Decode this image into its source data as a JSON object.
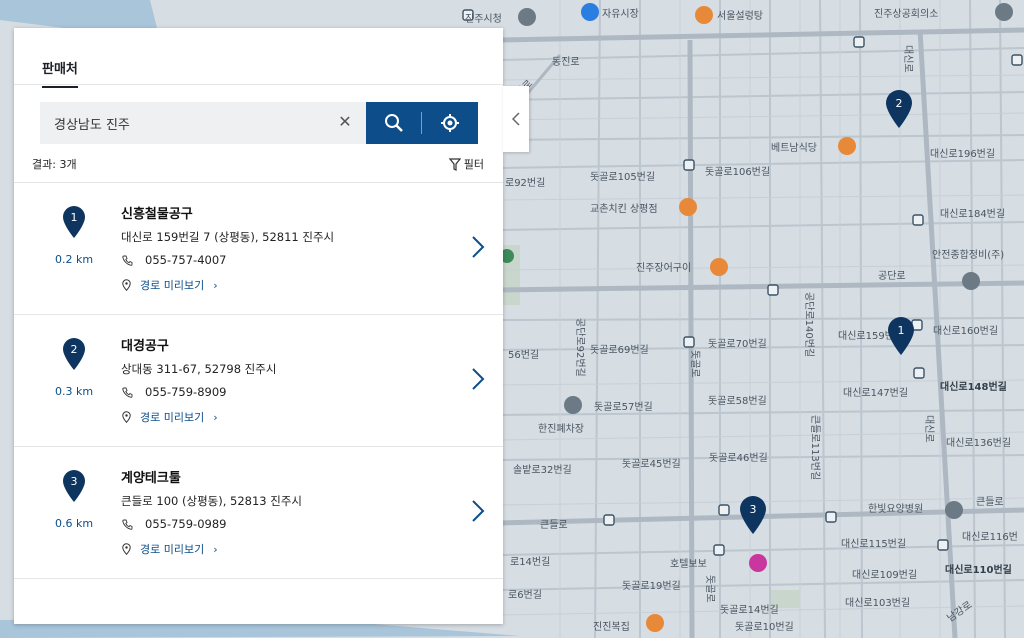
{
  "map": {
    "labels": {
      "jinju_city_hall": "진주시청",
      "jayu_market": "자유시장",
      "seoul_seolleongtang": "서울설렁탕",
      "jinju_chamber": "진주상공회의소",
      "dongjinro": "동진로",
      "dodongcheonro": "도동천로",
      "daesinro_v1": "대신로",
      "betnam": "베트남식당",
      "daesinro196": "대신로196번길",
      "dotgol105": "돗골로105번길",
      "dotgol106": "돗골로106번길",
      "ro292": "로92번길",
      "gyochon": "교촌치킨 상평점",
      "daesinro184": "대신로184번길",
      "anjin": "안전종합정비(주)",
      "jinju_eel": "진주장어구이",
      "gongdanro": "공단로",
      "daesinro159": "대신로159번",
      "daesinro160": "대신로160번길",
      "gongdanro140": "공단로140번길",
      "gongdanro92": "공단로92번길",
      "ro56": "56번길",
      "dotgol69": "돗골로69번길",
      "dotgol70": "돗골로70번길",
      "daesinro148": "대신로148번길",
      "dotgolro_v": "돗골로",
      "daesinro147": "대신로147번길",
      "dotgol57": "돗골로57번길",
      "dotgol58": "돗골로58번길",
      "hanjin": "한진폐차장",
      "daesinro136": "대신로136번길",
      "daesinro_v2": "대신로",
      "keundeulro113": "큰들로113번길",
      "solbat32": "솔밭로32번길",
      "dotgol45": "돗골로45번길",
      "dotgol46": "돗골로46번길",
      "hanbit": "한빛요양병원",
      "keundeulro_r": "큰들로",
      "keundeulro_l": "큰들로",
      "daesinro116": "대신로116번",
      "daesinro115": "대신로115번길",
      "ro14": "로14번길",
      "hotel": "호텔보보",
      "daesinro110": "대신로110번길",
      "daesinro109": "대신로109번길",
      "dotgol19": "돗골로19번길",
      "dotgolro_v2": "돗골로",
      "ro6": "로6번길",
      "daesinro103": "대신로103번길",
      "dotgol14": "돗골로14번길",
      "jinjin": "진진복집",
      "dotgol10": "돗골로10번길",
      "nambuk": "남강로"
    }
  },
  "panel": {
    "tab_label": "판매처",
    "search_value": "경상남도 진주",
    "result_count": "결과: 3개",
    "filter_label": "필터",
    "route_label": "경로 미리보기",
    "items": [
      {
        "pin": "1",
        "distance": "0.2 km",
        "name": "신흥철물공구",
        "address": "대신로 159번길 7 (상평동), 52811 진주시",
        "phone": "055-757-4007"
      },
      {
        "pin": "2",
        "distance": "0.3 km",
        "name": "대경공구",
        "address": "상대동 311-67, 52798 진주시",
        "phone": "055-759-8909"
      },
      {
        "pin": "3",
        "distance": "0.6 km",
        "name": "계양테크툴",
        "address": "큰들로 100 (상평동), 52813 진주시",
        "phone": "055-759-0989"
      }
    ]
  },
  "colors": {
    "accent": "#0d4e8a",
    "pin": "#0d3560",
    "map_bg": "#d6dde3",
    "road": "#b9c3cc"
  },
  "map_markers": [
    {
      "label": "1"
    },
    {
      "label": "2"
    },
    {
      "label": "3"
    }
  ]
}
